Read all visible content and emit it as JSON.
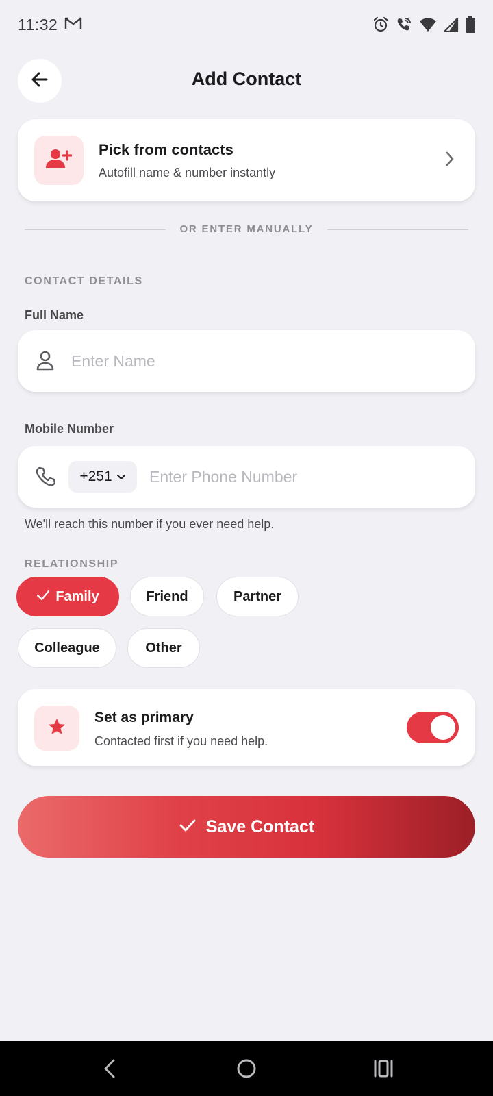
{
  "status_bar": {
    "time": "11:32",
    "icons": [
      "gmail-icon",
      "alarm-icon",
      "wifi-calling-icon",
      "wifi-icon",
      "signal-icon",
      "battery-icon"
    ]
  },
  "header": {
    "title": "Add Contact",
    "back_icon": "arrow-left-icon"
  },
  "pick_contacts": {
    "title": "Pick from contacts",
    "subtitle": "Autofill name & number instantly",
    "icon": "person-add-icon"
  },
  "divider": {
    "text": "OR ENTER MANUALLY"
  },
  "contact_details": {
    "section_label": "CONTACT DETAILS",
    "full_name": {
      "label": "Full Name",
      "value": "",
      "placeholder": "Enter Name",
      "icon": "person-icon"
    },
    "mobile": {
      "label": "Mobile Number",
      "country_code": "+251",
      "value": "",
      "placeholder": "Enter Phone Number",
      "icon": "phone-icon",
      "helper": "We'll reach this number if you ever need help."
    }
  },
  "relationship": {
    "section_label": "RELATIONSHIP",
    "options": [
      {
        "label": "Family",
        "selected": true
      },
      {
        "label": "Friend",
        "selected": false
      },
      {
        "label": "Partner",
        "selected": false
      },
      {
        "label": "Colleague",
        "selected": false
      },
      {
        "label": "Other",
        "selected": false
      }
    ]
  },
  "primary": {
    "title": "Set as primary",
    "subtitle": "Contacted first if you need help.",
    "enabled": true,
    "icon": "star-icon"
  },
  "save_button": {
    "label": "Save Contact",
    "icon": "check-icon"
  },
  "colors": {
    "accent": "#e53945",
    "accent_light": "#fde7e8",
    "background": "#f0f0f5"
  },
  "nav_bar": {
    "buttons": [
      "back-nav-icon",
      "home-nav-icon",
      "recents-nav-icon"
    ]
  }
}
